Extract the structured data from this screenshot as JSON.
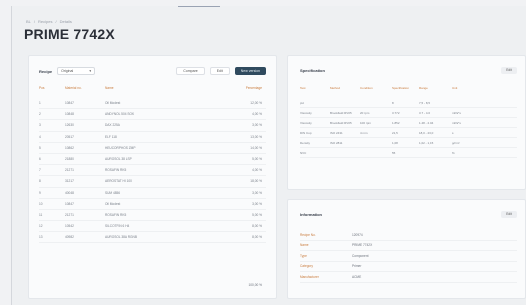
{
  "breadcrumb": [
    "BL",
    "/",
    "Recipes",
    "/",
    "Details"
  ],
  "page": {
    "title": "PRIME 7742X"
  },
  "recipe_panel": {
    "label": "Recipe",
    "select_value": "Original",
    "buttons": {
      "compare": "Compare",
      "edit": "Edit",
      "new_version": "New version"
    },
    "columns": [
      "Pos",
      "Material no.",
      "Name",
      "Percentage"
    ],
    "rows": [
      {
        "pos": "1",
        "material": "10847",
        "name": "Oil Modest",
        "pct": "12,00 %"
      },
      {
        "pos": "2",
        "material": "10848",
        "name": "ANDYNOL 504 SOK",
        "pct": "4,00 %"
      },
      {
        "pos": "3",
        "material": "12630",
        "name": "DAX 225A",
        "pct": "3,00 %"
      },
      {
        "pos": "4",
        "material": "20517",
        "name": "ELF 118",
        "pct": "13,00 %"
      },
      {
        "pos": "5",
        "material": "10862",
        "name": "HEUCORPHOS ZMP",
        "pct": "14,00 %"
      },
      {
        "pos": "6",
        "material": "21880",
        "name": "AUROSOL 38 LSP",
        "pct": "5,00 %"
      },
      {
        "pos": "7",
        "material": "21271",
        "name": "ROSAFIN RK5",
        "pct": "4,00 %"
      },
      {
        "pos": "8",
        "material": "31217",
        "name": "AEROSTAT HI 100",
        "pct": "18,00 %"
      },
      {
        "pos": "9",
        "material": "40048",
        "name": "SUM 4856",
        "pct": "3,00 %"
      },
      {
        "pos": "10",
        "material": "10847",
        "name": "Oil Modest",
        "pct": "3,00 %"
      },
      {
        "pos": "11",
        "material": "21271",
        "name": "ROSAFIN RK5",
        "pct": "5,00 %"
      },
      {
        "pos": "12",
        "material": "10542",
        "name": "SILCOTFIN 6 H4",
        "pct": "8,00 %"
      },
      {
        "pos": "13",
        "material": "40982",
        "name": "AUROSOL 38A RGNB",
        "pct": "8,00 %"
      }
    ],
    "total": "100,00 %"
  },
  "specification": {
    "title": "Specification",
    "edit_label": "Edit",
    "columns": [
      "Test",
      "Method",
      "Condition",
      "Specification",
      "Range",
      "Unit"
    ],
    "rows": [
      {
        "test": "pH",
        "method": "",
        "condition": "",
        "spec": "8",
        "range": "7,5 - 8,5",
        "unit": ""
      },
      {
        "test": "Viscosity",
        "method": "Brookfield RV05",
        "condition": "20 rpm",
        "spec": "3.772",
        "range": "3.7 - 4.0",
        "unit": "mPa*s"
      },
      {
        "test": "Viscosity",
        "method": "Brookfield RV05",
        "condition": "100 rpm",
        "spec": "1.852",
        "range": "1.48 - 2.04",
        "unit": "mPa*s"
      },
      {
        "test": "DIN Cup",
        "method": "ISO 2431",
        "condition": "4 mm",
        "spec": "21,5",
        "range": "18,0 - 23,0",
        "unit": "s"
      },
      {
        "test": "Density",
        "method": "ISO 2811",
        "condition": "",
        "spec": "1,08",
        "range": "1,02 - 1,15",
        "unit": "g/cm³"
      },
      {
        "test": "NVC",
        "method": "",
        "condition": "",
        "spec": "55",
        "range": "",
        "unit": "%"
      }
    ]
  },
  "information": {
    "title": "Information",
    "edit_label": "Edit",
    "rows": [
      {
        "key": "Recipe No.",
        "value": "120974"
      },
      {
        "key": "Name",
        "value": "PRIME 7742X"
      },
      {
        "key": "Type",
        "value": "Component"
      },
      {
        "key": "Category",
        "value": "Primer"
      },
      {
        "key": "Manufacturer",
        "value": "ACME"
      }
    ]
  }
}
